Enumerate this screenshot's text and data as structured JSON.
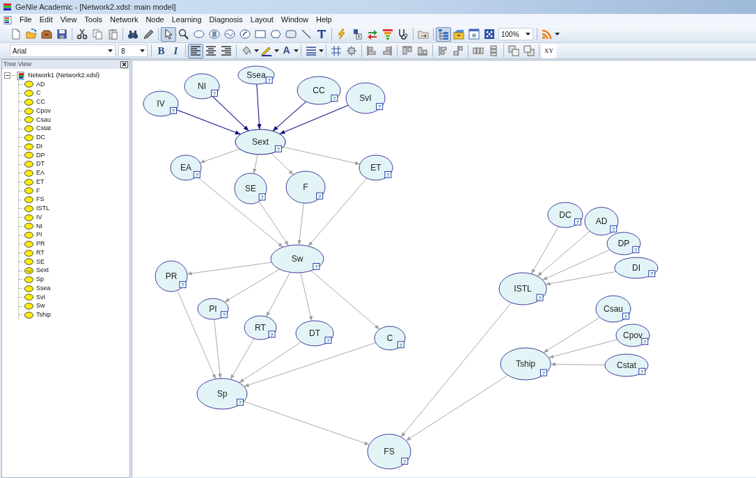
{
  "window": {
    "title": "GeNIe Academic - [Network2.xdsl: main model]"
  },
  "menu": [
    "File",
    "Edit",
    "View",
    "Tools",
    "Network",
    "Node",
    "Learning",
    "Diagnosis",
    "Layout",
    "Window",
    "Help"
  ],
  "toolbar": [
    {
      "kind": "new",
      "pressed": false
    },
    {
      "kind": "open",
      "pressed": false
    },
    {
      "kind": "box",
      "pressed": false
    },
    {
      "kind": "save",
      "pressed": false
    },
    {
      "kind": "sep"
    },
    {
      "kind": "cut",
      "pressed": false
    },
    {
      "kind": "copy",
      "pressed": false
    },
    {
      "kind": "paste",
      "pressed": false
    },
    {
      "kind": "sep"
    },
    {
      "kind": "binoculars",
      "pressed": false
    },
    {
      "kind": "marker",
      "pressed": false
    },
    {
      "kind": "sep"
    },
    {
      "kind": "pointer",
      "pressed": true
    },
    {
      "kind": "magnifier",
      "pressed": false
    },
    {
      "kind": "oval",
      "pressed": false
    },
    {
      "kind": "oval-dial",
      "pressed": false
    },
    {
      "kind": "oval-wave",
      "pressed": false
    },
    {
      "kind": "oval-curve",
      "pressed": false
    },
    {
      "kind": "rect",
      "pressed": false
    },
    {
      "kind": "hexagon",
      "pressed": false
    },
    {
      "kind": "roundrect",
      "pressed": false
    },
    {
      "kind": "line",
      "pressed": false
    },
    {
      "kind": "text-tool",
      "pressed": false
    },
    {
      "kind": "sep"
    },
    {
      "kind": "lightning",
      "pressed": false
    },
    {
      "kind": "doc-down",
      "pressed": false
    },
    {
      "kind": "swap",
      "pressed": false
    },
    {
      "kind": "funnel",
      "pressed": false
    },
    {
      "kind": "stethoscope",
      "pressed": false
    },
    {
      "kind": "sep"
    },
    {
      "kind": "folder",
      "pressed": false
    },
    {
      "kind": "sep"
    },
    {
      "kind": "tree",
      "pressed": true
    },
    {
      "kind": "cabinet",
      "pressed": false
    },
    {
      "kind": "window",
      "pressed": false
    },
    {
      "kind": "dots",
      "pressed": false
    },
    {
      "kind": "zoom",
      "value": "100%"
    },
    {
      "kind": "sep"
    },
    {
      "kind": "rss",
      "pressed": false
    }
  ],
  "format_toolbar": [
    {
      "kind": "font",
      "value": "Arial"
    },
    {
      "kind": "size",
      "value": "8"
    },
    {
      "kind": "sep"
    },
    {
      "kind": "bold",
      "label": "B",
      "pressed": false
    },
    {
      "kind": "italic",
      "label": "I",
      "pressed": false
    },
    {
      "kind": "sep"
    },
    {
      "kind": "align-left",
      "pressed": true
    },
    {
      "kind": "align-center",
      "pressed": false
    },
    {
      "kind": "align-right",
      "pressed": false
    },
    {
      "kind": "sep"
    },
    {
      "kind": "fill",
      "pressed": false
    },
    {
      "kind": "pen",
      "pressed": false
    },
    {
      "kind": "font-color",
      "label": "A",
      "pressed": false
    },
    {
      "kind": "sep"
    },
    {
      "kind": "lines",
      "pressed": false
    },
    {
      "kind": "sep"
    },
    {
      "kind": "grid",
      "pressed": false
    },
    {
      "kind": "frame",
      "pressed": false
    },
    {
      "kind": "sep"
    },
    {
      "kind": "align-a",
      "pressed": false
    },
    {
      "kind": "align-b",
      "pressed": false
    },
    {
      "kind": "sep"
    },
    {
      "kind": "align-c",
      "pressed": false
    },
    {
      "kind": "align-d",
      "pressed": false
    },
    {
      "kind": "sep"
    },
    {
      "kind": "align-e",
      "pressed": false
    },
    {
      "kind": "align-f",
      "pressed": false
    },
    {
      "kind": "sep"
    },
    {
      "kind": "space-h",
      "pressed": false
    },
    {
      "kind": "space-v",
      "pressed": false
    },
    {
      "kind": "sep"
    },
    {
      "kind": "front",
      "pressed": false
    },
    {
      "kind": "back",
      "pressed": false
    },
    {
      "kind": "sep"
    },
    {
      "kind": "xy",
      "label": "XY",
      "pressed": false
    }
  ],
  "tree_view": {
    "title": "Tree View",
    "root": {
      "label": "Network1 (Network2.xdsl)",
      "expanded": true,
      "children": [
        {
          "label": "AD",
          "kind": "chance"
        },
        {
          "label": "C",
          "kind": "chance"
        },
        {
          "label": "CC",
          "kind": "chance"
        },
        {
          "label": "Cpov",
          "kind": "chance"
        },
        {
          "label": "Csau",
          "kind": "chance"
        },
        {
          "label": "Cstat",
          "kind": "chance"
        },
        {
          "label": "DC",
          "kind": "chance"
        },
        {
          "label": "DI",
          "kind": "chance"
        },
        {
          "label": "DP",
          "kind": "chance"
        },
        {
          "label": "DT",
          "kind": "chance"
        },
        {
          "label": "EA",
          "kind": "chance"
        },
        {
          "label": "ET",
          "kind": "chance"
        },
        {
          "label": "F",
          "kind": "chance"
        },
        {
          "label": "FS",
          "kind": "chance"
        },
        {
          "label": "ISTL",
          "kind": "chance"
        },
        {
          "label": "IV",
          "kind": "chance"
        },
        {
          "label": "NI",
          "kind": "chance"
        },
        {
          "label": "PI",
          "kind": "chance"
        },
        {
          "label": "PR",
          "kind": "chance"
        },
        {
          "label": "RT",
          "kind": "chance"
        },
        {
          "label": "SE",
          "kind": "chance"
        },
        {
          "label": "Sext",
          "kind": "equation"
        },
        {
          "label": "Sp",
          "kind": "chance"
        },
        {
          "label": "Ssea",
          "kind": "chance"
        },
        {
          "label": "SvI",
          "kind": "chance"
        },
        {
          "label": "Sw",
          "kind": "chance"
        },
        {
          "label": "Tship",
          "kind": "chance"
        }
      ]
    }
  },
  "canvas": {
    "nodes": [
      {
        "label": "IV",
        "badge": "?",
        "selected": false
      },
      {
        "label": "NI",
        "badge": "?",
        "selected": false
      },
      {
        "label": "Ssea",
        "badge": "?",
        "selected": false
      },
      {
        "label": "CC",
        "badge": "?",
        "selected": false
      },
      {
        "label": "SvI",
        "badge": "?",
        "selected": false
      },
      {
        "label": "Sext",
        "badge": "?",
        "selected": true
      },
      {
        "label": "EA",
        "badge": "?",
        "selected": false
      },
      {
        "label": "SE",
        "badge": "?",
        "selected": false
      },
      {
        "label": "F",
        "badge": "?",
        "selected": false
      },
      {
        "label": "ET",
        "badge": "?",
        "selected": false
      },
      {
        "label": "Sw",
        "badge": "?",
        "selected": false
      },
      {
        "label": "PR",
        "badge": "?",
        "selected": false
      },
      {
        "label": "PI",
        "badge": "?",
        "selected": false
      },
      {
        "label": "RT",
        "badge": "?",
        "selected": false
      },
      {
        "label": "DT",
        "badge": "?",
        "selected": false
      },
      {
        "label": "C",
        "badge": "?",
        "selected": false
      },
      {
        "label": "Sp",
        "badge": "?",
        "selected": false
      },
      {
        "label": "FS",
        "badge": "?",
        "selected": false
      },
      {
        "label": "DC",
        "badge": "?",
        "selected": false
      },
      {
        "label": "AD",
        "badge": "?",
        "selected": false
      },
      {
        "label": "DP",
        "badge": "?",
        "selected": false
      },
      {
        "label": "DI",
        "badge": "?",
        "selected": false
      },
      {
        "label": "ISTL",
        "badge": "?",
        "selected": false
      },
      {
        "label": "Csau",
        "badge": "?",
        "selected": false
      },
      {
        "label": "Cpov",
        "badge": "?",
        "selected": false
      },
      {
        "label": "Tship",
        "badge": "?",
        "selected": false
      },
      {
        "label": "Cstat",
        "badge": "?",
        "selected": false
      }
    ]
  }
}
